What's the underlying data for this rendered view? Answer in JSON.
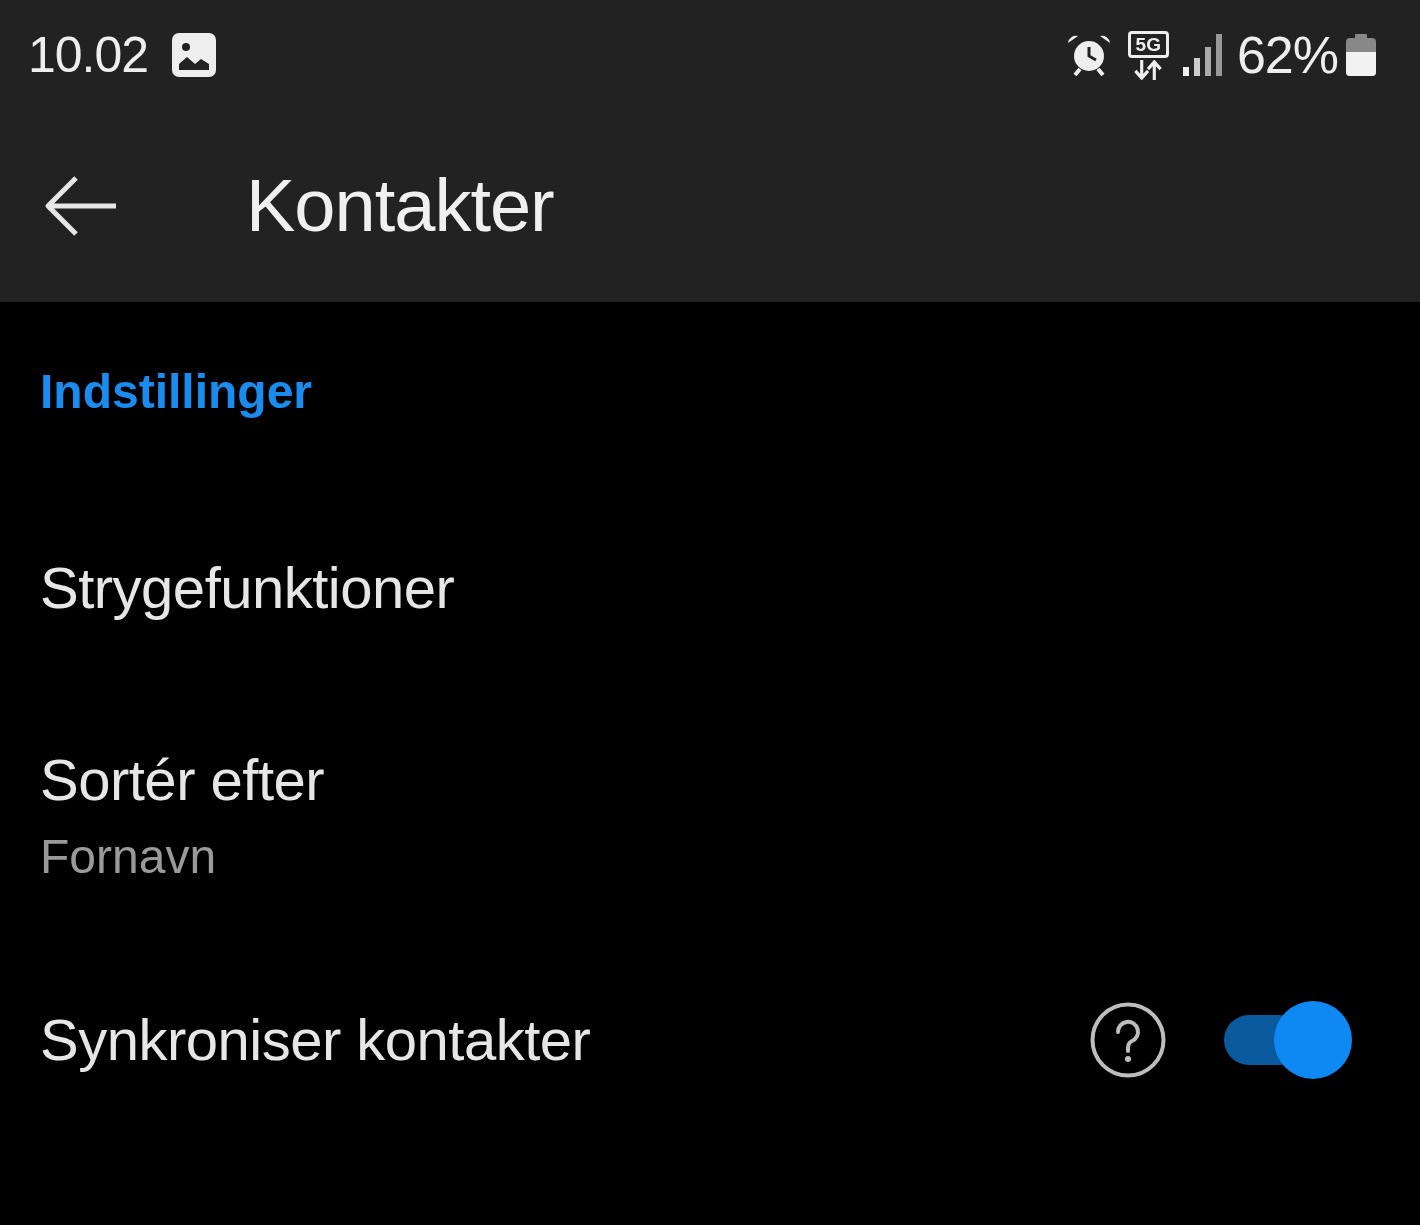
{
  "status_bar": {
    "time": "10.02",
    "network_type": "5G",
    "battery": "62%"
  },
  "app_bar": {
    "title": "Kontakter"
  },
  "section": {
    "title": "Indstillinger"
  },
  "items": [
    {
      "kind": "link",
      "title": "Strygefunktioner"
    },
    {
      "kind": "value",
      "title": "Sortér efter",
      "value": "Fornavn"
    },
    {
      "kind": "toggle",
      "title": "Synkroniser kontakter",
      "on": true
    }
  ]
}
